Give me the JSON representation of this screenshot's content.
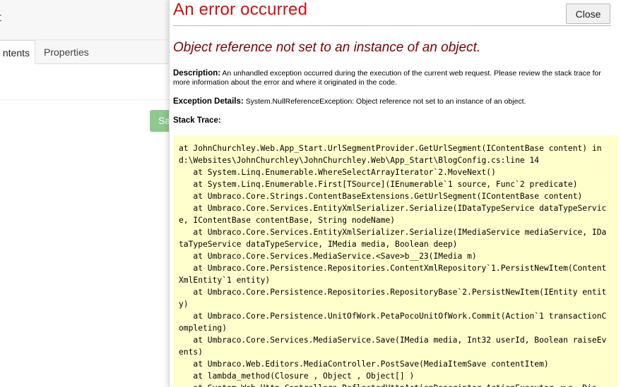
{
  "background": {
    "title_fragment": "t",
    "tabs": {
      "contents": "ntents",
      "properties": "Properties"
    },
    "save_fragment": "Save"
  },
  "error": {
    "title": "An error occurred",
    "close_label": "Close",
    "message": "Object reference not set to an instance of an object.",
    "description_label": "Description:",
    "description_text": " An unhandled exception occurred during the execution of the current web request. Please review the stack trace for more information about the error and where it originated in the code.",
    "exception_label": "Exception Details:",
    "exception_text": " System.NullReferenceException: Object reference not set to an instance of an object.",
    "stack_trace_label": "Stack Trace:",
    "stack_trace": "at JohnChurchley.Web.App_Start.UrlSegmentProvider.GetUrlSegment(IContentBase content) in d:\\Websites\\JohnChurchley\\JohnChurchley.Web\\App_Start\\BlogConfig.cs:line 14\n   at System.Linq.Enumerable.WhereSelectArrayIterator`2.MoveNext()\n   at System.Linq.Enumerable.First[TSource](IEnumerable`1 source, Func`2 predicate)\n   at Umbraco.Core.Strings.ContentBaseExtensions.GetUrlSegment(IContentBase content)\n   at Umbraco.Core.Services.EntityXmlSerializer.Serialize(IDataTypeService dataTypeService, IContentBase contentBase, String nodeName)\n   at Umbraco.Core.Services.EntityXmlSerializer.Serialize(IMediaService mediaService, IDataTypeService dataTypeService, IMedia media, Boolean deep)\n   at Umbraco.Core.Services.MediaService.<Save>b__23(IMedia m)\n   at Umbraco.Core.Persistence.Repositories.ContentXmlRepository`1.PersistNewItem(ContentXmlEntity`1 entity)\n   at Umbraco.Core.Persistence.Repositories.RepositoryBase`2.PersistNewItem(IEntity entity)\n   at Umbraco.Core.Persistence.UnitOfWork.PetaPocoUnitOfWork.Commit(Action`1 transactionCompleting)\n   at Umbraco.Core.Services.MediaService.Save(IMedia media, Int32 userId, Boolean raiseEvents)\n   at Umbraco.Web.Editors.MediaController.PostSave(MediaItemSave contentItem)\n   at lambda_method(Closure , Object , Object[] )\n   at System.Web.Http.Controllers.ReflectedHttpActionDescriptor.ActionExecutor.<>c__Dis"
  }
}
